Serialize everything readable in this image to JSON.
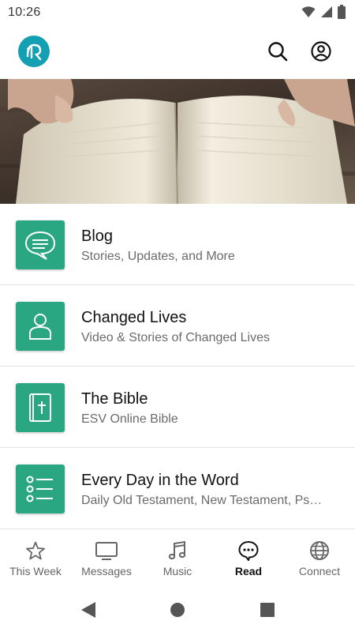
{
  "status_bar": {
    "time": "10:26",
    "icons": [
      "wifi-icon",
      "signal-icon",
      "battery-icon"
    ]
  },
  "app_bar": {
    "logo_icon": "church-logo-icon",
    "actions": [
      "search-icon",
      "account-icon"
    ]
  },
  "hero": {
    "image": "open-book-photo"
  },
  "menu": {
    "items": [
      {
        "title": "Blog",
        "subtitle": "Stories, Updates, and More",
        "icon": "chat-bubble-icon"
      },
      {
        "title": "Changed Lives",
        "subtitle": "Video & Stories of Changed Lives",
        "icon": "person-icon"
      },
      {
        "title": "The Bible",
        "subtitle": "ESV Online Bible",
        "icon": "bible-icon"
      },
      {
        "title": "Every Day in the Word",
        "subtitle": "Daily Old Testament, New Testament, Ps…",
        "icon": "list-icon"
      }
    ]
  },
  "bottom_nav": {
    "items": [
      {
        "label": "This Week",
        "icon": "star-icon",
        "active": false
      },
      {
        "label": "Messages",
        "icon": "tv-icon",
        "active": false
      },
      {
        "label": "Music",
        "icon": "music-note-icon",
        "active": false
      },
      {
        "label": "Read",
        "icon": "chat-icon",
        "active": true
      },
      {
        "label": "Connect",
        "icon": "globe-icon",
        "active": false
      }
    ]
  },
  "system_nav": [
    "back-icon",
    "home-icon",
    "recents-icon"
  ],
  "colors": {
    "accent_green": "#2aa683",
    "logo_teal": "#14a0b2"
  }
}
